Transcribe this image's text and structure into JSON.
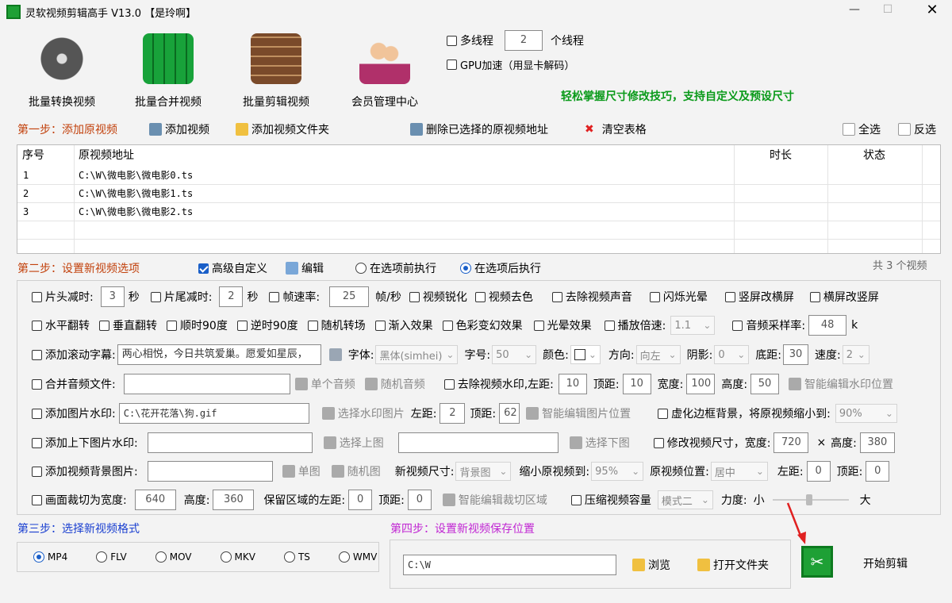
{
  "window": {
    "title": "灵软视频剪辑高手 V13.0 【是玲啊】"
  },
  "top": {
    "multithread_label": "多线程",
    "thread_count": "2",
    "thread_unit": "个线程",
    "gpu_label": "GPU加速（用显卡解码）",
    "tip": "轻松掌握尺寸修改技巧，支持自定义及预设尺寸"
  },
  "big_buttons": [
    "批量转换视频",
    "批量合并视频",
    "批量剪辑视频",
    "会员管理中心"
  ],
  "step1": {
    "title": "第一步：添加原视频",
    "add_video": "添加视频",
    "add_folder": "添加视频文件夹",
    "delete_selected": "删除已选择的原视频地址",
    "clear_table": "清空表格",
    "select_all": "全选",
    "invert": "反选"
  },
  "table": {
    "headers": [
      "序号",
      "原视频地址",
      "时长",
      "状态"
    ],
    "rows": [
      [
        "1",
        "C:\\W\\微电影\\微电影0.ts"
      ],
      [
        "2",
        "C:\\W\\微电影\\微电影1.ts"
      ],
      [
        "3",
        "C:\\W\\微电影\\微电影2.ts"
      ]
    ]
  },
  "step2": {
    "title": "第二步：设置新视频选项",
    "advanced": "高级自定义",
    "edit": "编辑",
    "before": "在选项前执行",
    "after": "在选项后执行",
    "count": "共 3 个视频"
  },
  "opts": {
    "head_cut": "片头减时:",
    "head_val": "3",
    "sec": "秒",
    "tail_cut": "片尾减时:",
    "tail_val": "2",
    "sec2": "秒",
    "fps": "帧速率:",
    "fps_val": "25",
    "fps_unit": "帧/秒",
    "sharpen": "视频锐化",
    "decolor": "视频去色",
    "mute": "去除视频声音",
    "flash": "闪烁光晕",
    "v2h": "竖屏改横屏",
    "h2v": "横屏改竖屏",
    "hflip": "水平翻转",
    "vflip": "垂直翻转",
    "cw90": "顺时90度",
    "ccw90": "逆时90度",
    "random_trans": "随机转场",
    "fade_in": "渐入效果",
    "color_fx": "色彩变幻效果",
    "halo": "光晕效果",
    "speed": "播放倍速:",
    "speed_val": "1.1",
    "samplerate": "音频采样率:",
    "samplerate_val": "48",
    "k": "k",
    "scroll_sub": "添加滚动字幕:",
    "scroll_text": "两心相悦，今日共筑爱巢。愿爱如星辰，",
    "font_lbl": "字体:",
    "font_val": "黑体(simhei)",
    "size_lbl": "字号:",
    "size_val": "50",
    "color_lbl": "颜色:",
    "dir_lbl": "方向:",
    "dir_val": "向左",
    "shadow_lbl": "阴影:",
    "shadow_val": "0",
    "bottom_lbl": "底距:",
    "bottom_val": "30",
    "spd_lbl": "速度:",
    "spd_val": "2",
    "merge_audio": "合并音频文件:",
    "single_audio": "单个音频",
    "random_audio": "随机音频",
    "rm_watermark": "去除视频水印,左距:",
    "wm_left": "10",
    "wm_top_lbl": "顶距:",
    "wm_top": "10",
    "wm_w_lbl": "宽度:",
    "wm_w": "100",
    "wm_h_lbl": "高度:",
    "wm_h": "50",
    "smart_wm": "智能编辑水印位置",
    "img_wm": "添加图片水印:",
    "img_wm_path": "C:\\花开花落\\狗.gif",
    "choose_wm": "选择水印图片",
    "iw_left_lbl": "左距:",
    "iw_left": "2",
    "iw_top_lbl": "顶距:",
    "iw_top": "62",
    "smart_img": "智能编辑图片位置",
    "blur_border": "虚化边框背景，将原视频缩小到:",
    "blur_val": "90%",
    "topbottom": "添加上下图片水印:",
    "choose_top": "选择上图",
    "choose_bottom": "选择下图",
    "resize": "修改视频尺寸，宽度:",
    "resize_w": "720",
    "x": "×",
    "resize_h_lbl": "高度:",
    "resize_h": "380",
    "bg_img": "添加视频背景图片:",
    "single_img": "单图",
    "random_img": "随机图",
    "new_size_lbl": "新视频尺寸:",
    "new_size_val": "背景图",
    "shrink_lbl": "缩小原视频到:",
    "shrink_val": "95%",
    "pos_lbl": "原视频位置:",
    "pos_val": "居中",
    "bg_left_lbl": "左距:",
    "bg_left": "0",
    "bg_top_lbl": "顶距:",
    "bg_top": "0",
    "crop": "画面裁切为宽度:",
    "crop_w": "640",
    "crop_h_lbl": "高度:",
    "crop_h": "360",
    "keep_left_lbl": "保留区域的左距:",
    "keep_left": "0",
    "keep_top_lbl": "顶距:",
    "keep_top": "0",
    "smart_crop": "智能编辑裁切区域",
    "compress": "压缩视频容量",
    "mode_val": "模式二",
    "force_lbl": "力度:",
    "small": "小",
    "big": "大"
  },
  "step3": {
    "title": "第三步：选择新视频格式",
    "formats": [
      "MP4",
      "FLV",
      "MOV",
      "MKV",
      "TS",
      "WMV"
    ]
  },
  "step4": {
    "title": "第四步：设置新视频保存位置",
    "path": "C:\\W",
    "browse": "浏览",
    "open_folder": "打开文件夹"
  },
  "start": {
    "label": "开始剪辑"
  }
}
